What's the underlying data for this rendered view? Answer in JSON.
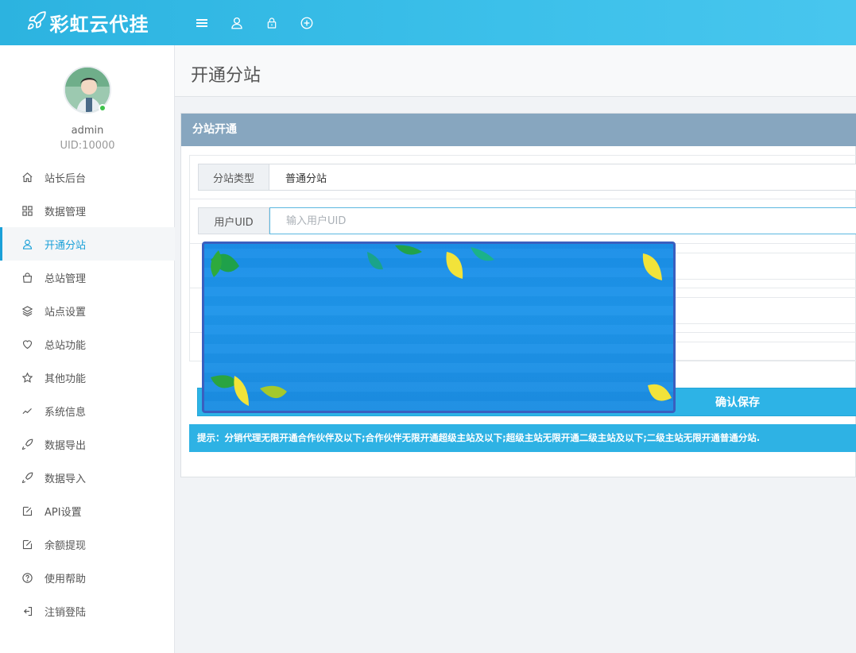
{
  "header": {
    "brand": "彩虹云代挂",
    "icons": [
      "menu-icon",
      "user-icon",
      "lock-icon",
      "plus-circle-icon"
    ]
  },
  "sidebar": {
    "username": "admin",
    "uid": "UID:10000",
    "items": [
      {
        "label": "站长后台",
        "icon": "home-icon"
      },
      {
        "label": "数据管理",
        "icon": "grid-icon"
      },
      {
        "label": "开通分站",
        "icon": "user-icon",
        "active": true
      },
      {
        "label": "总站管理",
        "icon": "bag-icon"
      },
      {
        "label": "站点设置",
        "icon": "layers-icon"
      },
      {
        "label": "总站功能",
        "icon": "heart-icon"
      },
      {
        "label": "其他功能",
        "icon": "star-icon"
      },
      {
        "label": "系统信息",
        "icon": "trend-icon"
      },
      {
        "label": "数据导出",
        "icon": "rocket-icon"
      },
      {
        "label": "数据导入",
        "icon": "rocket-icon"
      },
      {
        "label": "API设置",
        "icon": "edit-icon"
      },
      {
        "label": "余额提现",
        "icon": "edit-icon"
      },
      {
        "label": "使用帮助",
        "icon": "help-icon"
      },
      {
        "label": "注销登陆",
        "icon": "logout-icon"
      }
    ]
  },
  "page": {
    "title": "开通分站"
  },
  "panel": {
    "title": "分站开通",
    "type_label": "分站类型",
    "type_value": "普通分站",
    "uid_label": "用户UID",
    "uid_placeholder": "输入用户UID",
    "uid_value": "",
    "save_label": "确认保存",
    "tip": "提示：分销代理无限开通合作伙伴及以下;合作伙伴无限开通超级主站及以下;超级主站无限开通二级主站及以下;二级主站无限开通普通分站."
  },
  "colors": {
    "accent": "#2db3e6",
    "panel_header": "#87a6bf",
    "active_nav": "#1aa0d8"
  }
}
